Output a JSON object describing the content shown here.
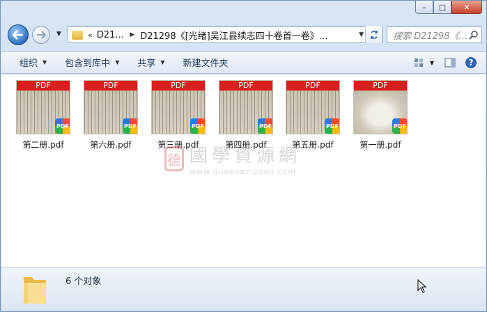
{
  "window": {
    "caption_buttons": [
      "minimize",
      "maximize",
      "close"
    ]
  },
  "nav": {
    "breadcrumb_prefix": "«",
    "crumb1": "D21…",
    "crumb2": "D21298《[光绪]吴江县续志四十卷首一卷》…",
    "search_placeholder": "搜索 D21298《…"
  },
  "toolbar": {
    "organize": "组织",
    "include_library": "包含到库中",
    "share": "共享",
    "new_folder": "新建文件夹"
  },
  "files": [
    {
      "name": "第二册.pdf",
      "thumb_label": "PDF",
      "badge": "PDF"
    },
    {
      "name": "第六册.pdf",
      "thumb_label": "PDF",
      "badge": "PDF"
    },
    {
      "name": "第三册.pdf",
      "thumb_label": "PDF",
      "badge": "PDF"
    },
    {
      "name": "第四册.pdf",
      "thumb_label": "PDF",
      "badge": "PDF"
    },
    {
      "name": "第五册.pdf",
      "thumb_label": "PDF",
      "badge": "PDF"
    },
    {
      "name": "第一册.pdf",
      "thumb_label": "PDF",
      "badge": "PDF"
    }
  ],
  "watermark": {
    "logo_char": "德",
    "title": "國學資源網",
    "url": "www.guoxueziyuan.com"
  },
  "status": {
    "count_text": "6 个对象"
  },
  "colors": {
    "pdf_banner": "#d81e1e",
    "toolbar_text": "#1e395b"
  }
}
